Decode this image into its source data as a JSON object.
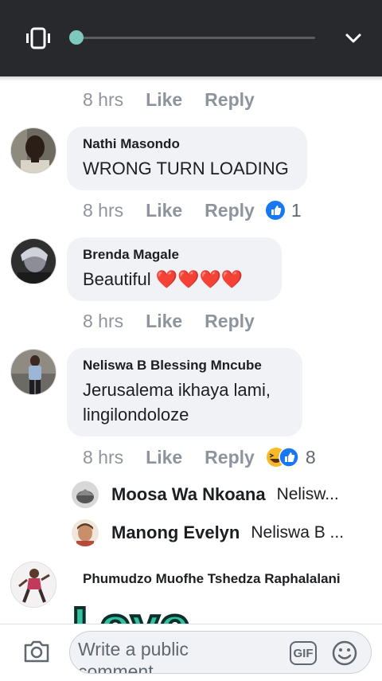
{
  "player": {
    "vibrate_icon": "vibrate-icon",
    "progress": 0.0,
    "collapse_icon": "chevron-down-icon"
  },
  "comments": [
    {
      "time": "8 hrs",
      "like": "Like",
      "reply": "Reply"
    },
    {
      "author": "Nathi Masondo",
      "text": "WRONG TURN LOADING",
      "time": "8 hrs",
      "like": "Like",
      "reply": "Reply",
      "reaction_count": "1",
      "reactions": [
        "like-reaction-icon"
      ]
    },
    {
      "author": "Brenda Magale",
      "text": "Beautiful ❤️❤️❤️❤️",
      "time": "8 hrs",
      "like": "Like",
      "reply": "Reply"
    },
    {
      "author": "Neliswa B Blessing Mncube",
      "text_line1": "Jerusalema ikhaya lami,",
      "text_line2": "lingilondoloze",
      "time": "8 hrs",
      "like": "Like",
      "reply": "Reply",
      "reaction_count": "8",
      "reactions": [
        "haha-reaction-icon",
        "like-reaction-icon"
      ]
    },
    {
      "author": "Phumudzo Muofhe Tshedza Raphalalani",
      "sticker_text": "Love"
    }
  ],
  "replies": [
    {
      "author": "Moosa Wa Nkoana",
      "preview": "Nelisw..."
    },
    {
      "author": "Manong Evelyn",
      "preview": "Neliswa B ..."
    }
  ],
  "composer": {
    "placeholder": "Write a public comment...",
    "gif_label": "GIF",
    "camera_icon": "camera-icon",
    "emoji_icon": "smiley-icon"
  },
  "colors": {
    "top_bar": "#27292c",
    "progress_knob": "#7fc8bd",
    "bubble": "#f0f2f5",
    "like_blue": "#1877f2",
    "heart_red": "#e4202f"
  }
}
